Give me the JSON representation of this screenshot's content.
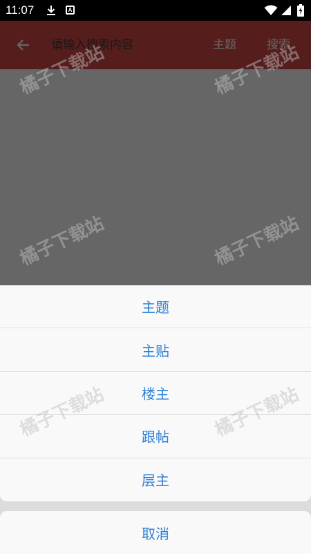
{
  "status_bar": {
    "time": "11:07",
    "download_icon": "download-icon",
    "notification_icon": "a-notification-icon",
    "notification_letter": "A",
    "wifi_icon": "wifi-icon",
    "signal_icon": "cell-signal-icon",
    "battery_icon": "battery-charging-icon"
  },
  "toolbar": {
    "back_icon": "arrow-back-icon",
    "search_placeholder": "请输入搜索内容",
    "search_value": "",
    "type_label": "主题",
    "search_button": "搜索",
    "background_color": "#d44c49"
  },
  "action_sheet": {
    "options": [
      {
        "label": "主题"
      },
      {
        "label": "主贴"
      },
      {
        "label": "楼主"
      },
      {
        "label": "跟帖"
      },
      {
        "label": "层主"
      }
    ],
    "cancel_label": "取消",
    "text_color": "#2f7fd9"
  },
  "watermark": {
    "text": "橘子下载站"
  }
}
